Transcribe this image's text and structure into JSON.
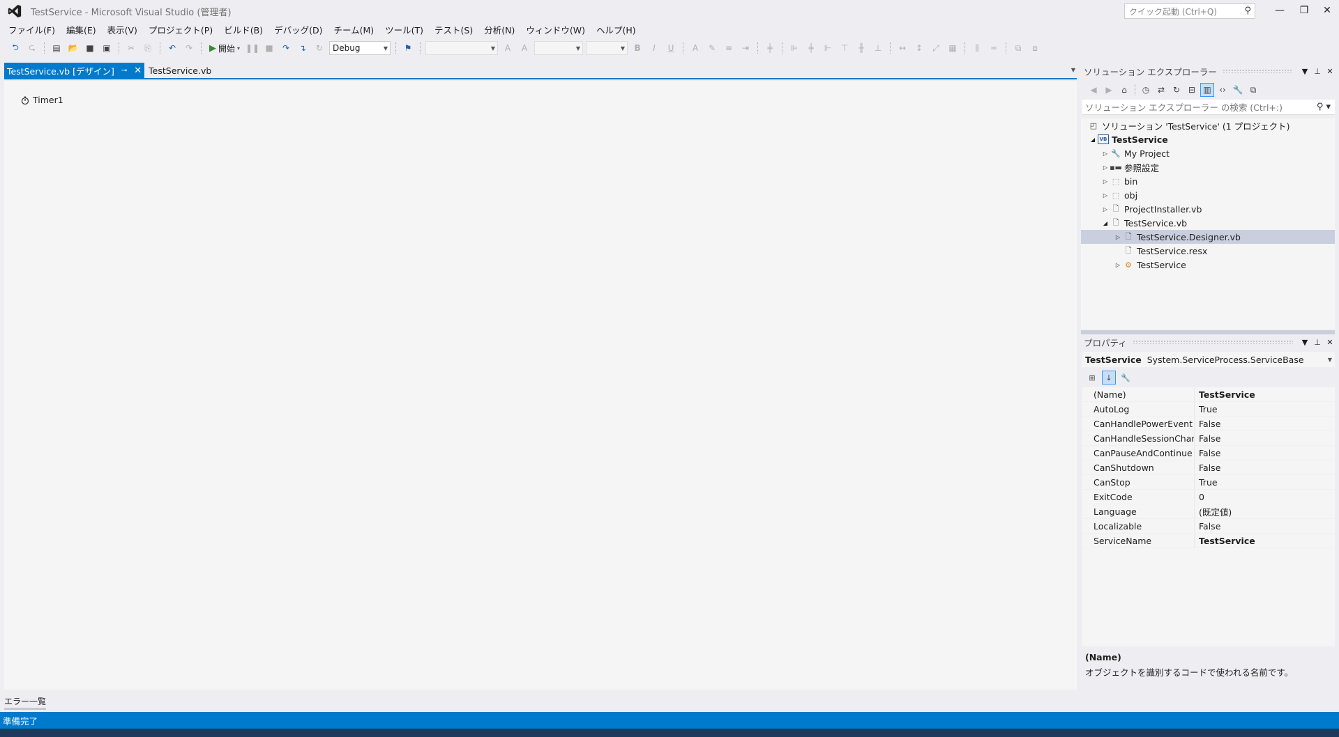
{
  "window": {
    "title": "TestService - Microsoft Visual Studio (管理者)",
    "quick_launch_placeholder": "クイック起動 (Ctrl+Q)"
  },
  "menu": [
    "ファイル(F)",
    "編集(E)",
    "表示(V)",
    "プロジェクト(P)",
    "ビルド(B)",
    "デバッグ(D)",
    "チーム(M)",
    "ツール(T)",
    "テスト(S)",
    "分析(N)",
    "ウィンドウ(W)",
    "ヘルプ(H)"
  ],
  "toolbar": {
    "start_label": "開始",
    "configuration": "Debug"
  },
  "doc_tabs": {
    "active": "TestService.vb [デザイン]",
    "inactive": "TestService.vb"
  },
  "designer": {
    "components": [
      "Timer1"
    ]
  },
  "solution_explorer": {
    "title": "ソリューション エクスプローラー",
    "search_placeholder": "ソリューション エクスプローラー の検索 (Ctrl+:)",
    "tree": [
      {
        "label": "ソリューション 'TestService' (1 プロジェクト)",
        "icon": "solution-icon",
        "expander": ""
      },
      {
        "label": "TestService",
        "icon": "vb-project-icon",
        "expander": "▲",
        "bold": true
      },
      {
        "label": "My Project",
        "icon": "wrench-icon",
        "expander": "▷"
      },
      {
        "label": "参照設定",
        "icon": "references-icon",
        "expander": "▷"
      },
      {
        "label": "bin",
        "icon": "folder-icon",
        "expander": "▷"
      },
      {
        "label": "obj",
        "icon": "folder-icon",
        "expander": "▷"
      },
      {
        "label": "ProjectInstaller.vb",
        "icon": "file-icon",
        "expander": "▷"
      },
      {
        "label": "TestService.vb",
        "icon": "file-icon",
        "expander": "◢"
      },
      {
        "label": "TestService.Designer.vb",
        "icon": "file-icon",
        "expander": "▷",
        "selected": true
      },
      {
        "label": "TestService.resx",
        "icon": "file-icon",
        "expander": ""
      },
      {
        "label": "TestService",
        "icon": "class-icon",
        "expander": "▷"
      }
    ]
  },
  "properties": {
    "title": "プロパティ",
    "object_name": "TestService",
    "object_type": "System.ServiceProcess.ServiceBase",
    "rows": [
      {
        "name": "(Name)",
        "value": "TestService",
        "bold": true
      },
      {
        "name": "AutoLog",
        "value": "True"
      },
      {
        "name": "CanHandlePowerEvent",
        "value": "False"
      },
      {
        "name": "CanHandleSessionChangeE",
        "value": "False"
      },
      {
        "name": "CanPauseAndContinue",
        "value": "False"
      },
      {
        "name": "CanShutdown",
        "value": "False"
      },
      {
        "name": "CanStop",
        "value": "True"
      },
      {
        "name": "ExitCode",
        "value": "0"
      },
      {
        "name": "Language",
        "value": "(既定値)"
      },
      {
        "name": "Localizable",
        "value": "False"
      },
      {
        "name": "ServiceName",
        "value": "TestService",
        "bold": true
      }
    ],
    "description_title": "(Name)",
    "description_text": "オブジェクトを識別するコードで使われる名前です。"
  },
  "bottom": {
    "error_list": "エラー一覧",
    "status": "準備完了"
  },
  "colors": {
    "accent": "#007acc",
    "selected_row": "#c9cfdf"
  }
}
